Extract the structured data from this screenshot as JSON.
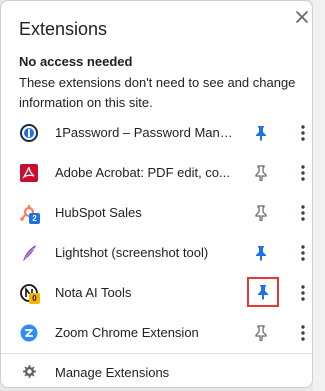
{
  "popup": {
    "title": "Extensions",
    "section_title": "No access needed",
    "section_desc": "These extensions don't need to see and change information on this site."
  },
  "extensions": [
    {
      "name": "1Password – Password Mana...",
      "icon": "1password-icon",
      "pinned": true
    },
    {
      "name": "Adobe Acrobat: PDF edit, co...",
      "icon": "adobe-acrobat-icon",
      "pinned": false
    },
    {
      "name": "HubSpot Sales",
      "icon": "hubspot-icon",
      "badge": "2",
      "pinned": false
    },
    {
      "name": "Lightshot (screenshot tool)",
      "icon": "lightshot-icon",
      "pinned": true
    },
    {
      "name": "Nota AI Tools",
      "icon": "nota-ai-icon",
      "badge": "0",
      "pinned": true,
      "highlighted": true
    },
    {
      "name": "Zoom Chrome Extension",
      "icon": "zoom-icon",
      "pinned": false
    }
  ],
  "footer": {
    "label": "Manage Extensions"
  },
  "colors": {
    "pin_active": "#1a73e8",
    "pin_inactive": "#5f6368",
    "highlight": "#e53935"
  }
}
